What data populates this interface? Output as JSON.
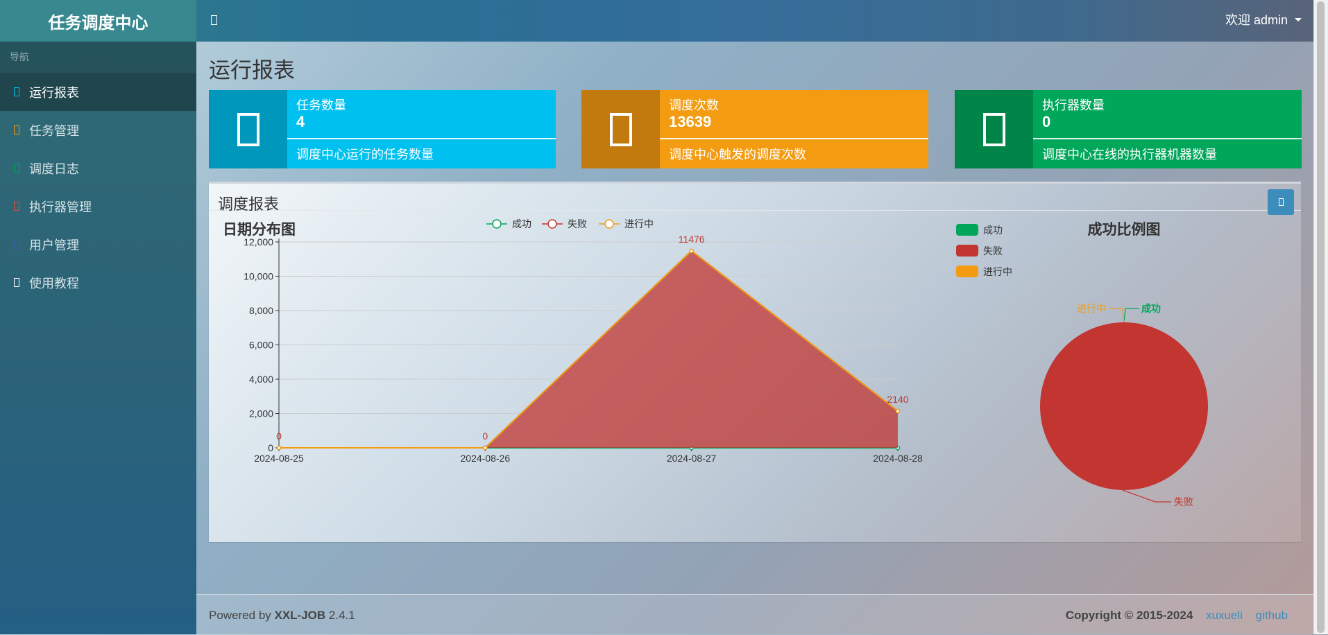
{
  "header": {
    "logo": "任务调度中心",
    "welcome": "欢迎 admin"
  },
  "sidebar": {
    "nav_header": "导航",
    "items": [
      {
        "label": "运行报表",
        "color": "#00c0ef",
        "active": true
      },
      {
        "label": "任务管理",
        "color": "#f39c12"
      },
      {
        "label": "调度日志",
        "color": "#00a65a"
      },
      {
        "label": "执行器管理",
        "color": "#dd4b39"
      },
      {
        "label": "用户管理",
        "color": "#3c5fa8"
      },
      {
        "label": "使用教程",
        "color": "#ffffff"
      }
    ]
  },
  "main": {
    "title": "运行报表",
    "info_boxes": [
      {
        "label": "任务数量",
        "number": "4",
        "desc": "调度中心运行的任务数量",
        "color": "#00c0ef",
        "icon_color": "#0097bc"
      },
      {
        "label": "调度次数",
        "number": "13639",
        "desc": "调度中心触发的调度次数",
        "color": "#f39c12",
        "icon_color": "#c2790e"
      },
      {
        "label": "执行器数量",
        "number": "0",
        "desc": "调度中心在线的执行器机器数量",
        "color": "#00a65a",
        "icon_color": "#008548"
      }
    ],
    "panel_title": "调度报表"
  },
  "chart_data": [
    {
      "type": "line",
      "title": "日期分布图",
      "x": [
        "2024-08-25",
        "2024-08-26",
        "2024-08-27",
        "2024-08-28"
      ],
      "series": [
        {
          "name": "成功",
          "values": [
            0,
            0,
            0,
            0
          ],
          "color": "#00a65a"
        },
        {
          "name": "失败",
          "values": [
            0,
            0,
            11476,
            2140
          ],
          "color": "#c23531"
        },
        {
          "name": "进行中",
          "values": [
            0,
            0,
            0,
            0
          ],
          "color": "#f39c12"
        }
      ],
      "data_labels": [
        {
          "text": "0",
          "x": "2024-08-25",
          "y": 0
        },
        {
          "text": "0",
          "x": "2024-08-26",
          "y": 0
        },
        {
          "text": "11476",
          "x": "2024-08-27",
          "y": 11476
        },
        {
          "text": "2140",
          "x": "2024-08-28",
          "y": 2140
        }
      ],
      "yticks": [
        "0",
        "2,000",
        "4,000",
        "6,000",
        "8,000",
        "10,000",
        "12,000"
      ],
      "ylim": [
        0,
        12000
      ],
      "stacked_area": true,
      "legend_position": "top-center"
    },
    {
      "type": "pie",
      "title": "成功比例图",
      "slices": [
        {
          "name": "成功",
          "value": 0,
          "color": "#00a65a"
        },
        {
          "name": "失败",
          "value": 13616,
          "color": "#c23531"
        },
        {
          "name": "进行中",
          "value": 0,
          "color": "#f39c12"
        }
      ],
      "legend_position": "top-left"
    }
  ],
  "footer": {
    "powered_prefix": "Powered by ",
    "powered_name": "XXL-JOB",
    "version": " 2.4.1",
    "copyright": "Copyright © 2015-2024",
    "link1": "xuxueli",
    "link2": "github"
  }
}
